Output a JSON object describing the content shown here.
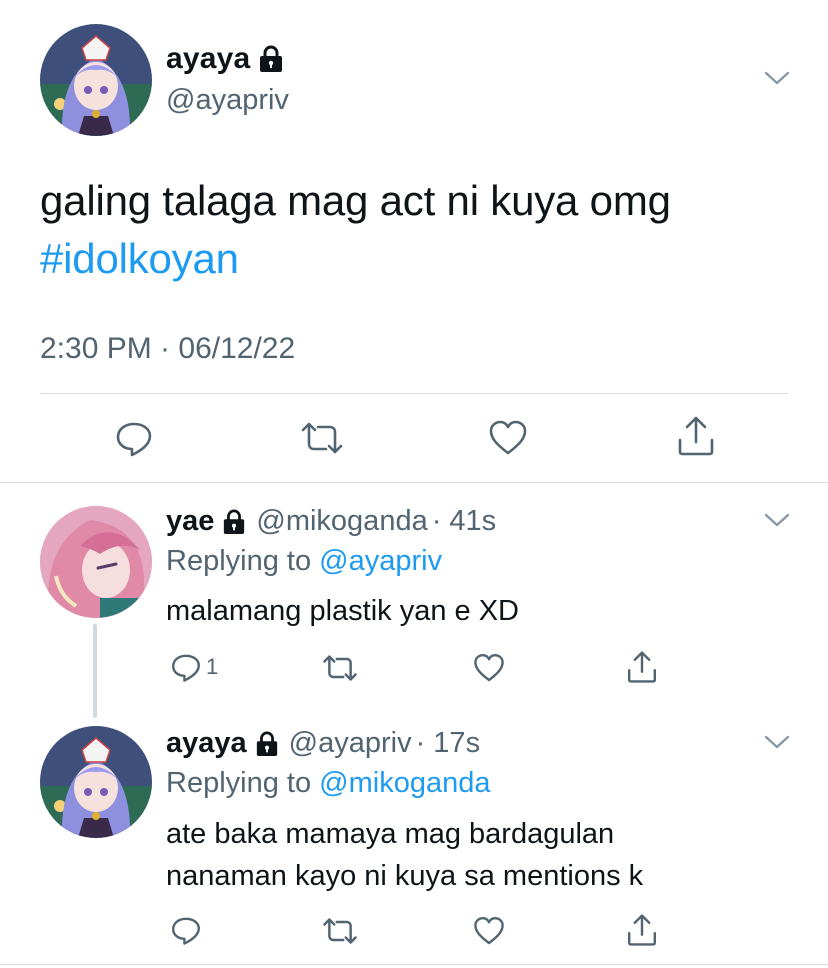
{
  "main_tweet": {
    "display_name": "ayaya",
    "handle": "@ayapriv",
    "text": "galing talaga mag act ni kuya omg",
    "hashtag": "#idolkoyan",
    "timestamp": "2:30 PM · 06/12/22",
    "avatar_icon": "anime-avatar-purple-hair",
    "protected_icon": "lock-icon"
  },
  "replies": [
    {
      "display_name": "yae",
      "handle": "@mikoganda",
      "time": "· 41s",
      "replying_label": "Replying to",
      "replying_to": "@ayapriv",
      "text_lines": [
        "malamang plastik yan e XD"
      ],
      "reply_count": "1",
      "avatar_icon": "anime-avatar-pink-hair"
    },
    {
      "display_name": "ayaya",
      "handle": "@ayapriv",
      "time": "· 17s",
      "replying_label": "Replying to",
      "replying_to": "@mikoganda",
      "text_lines": [
        "ate baka mamaya mag bardagulan",
        "nanaman kayo ni kuya sa mentions k"
      ],
      "reply_count": "",
      "avatar_icon": "anime-avatar-purple-hair"
    }
  ],
  "colors": {
    "link": "#1d9bf0",
    "secondary_text": "#536471",
    "primary_text": "#0f1419",
    "divider": "#d5dbe0"
  }
}
